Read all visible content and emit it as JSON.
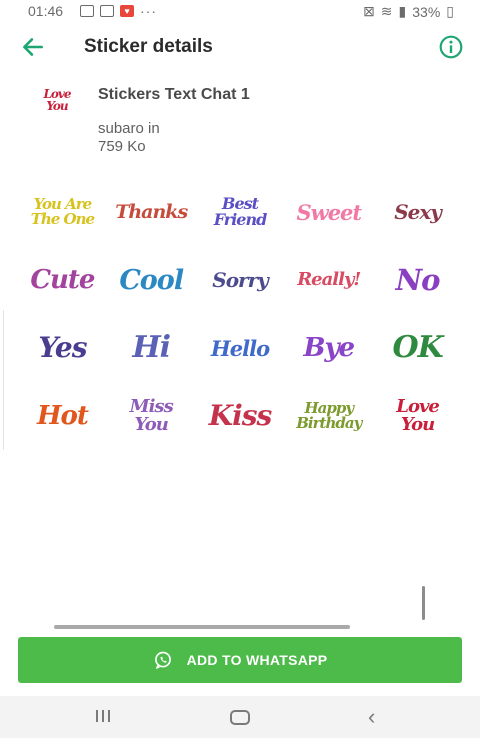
{
  "status_bar": {
    "time": "01:46",
    "battery": "33%"
  },
  "header": {
    "title": "Sticker details"
  },
  "pack": {
    "thumb_text": "Love You",
    "name": "Stickers Text Chat 1",
    "author": "subaro in",
    "size": "759 Ko"
  },
  "stickers": [
    {
      "text": "You Are The One",
      "color": "#d8c21d"
    },
    {
      "text": "Thanks",
      "color": "#c64b3b"
    },
    {
      "text": "Best Friend",
      "color": "#5a4fc4"
    },
    {
      "text": "Sweet",
      "color": "#f07aa5"
    },
    {
      "text": "Sexy",
      "color": "#8b3a4a"
    },
    {
      "text": "Cute",
      "color": "#a2439e"
    },
    {
      "text": "Cool",
      "color": "#2b88c3"
    },
    {
      "text": "Sorry",
      "color": "#4b4b8e"
    },
    {
      "text": "Really!",
      "color": "#d84b63"
    },
    {
      "text": "No",
      "color": "#8a3fc2"
    },
    {
      "text": "Yes",
      "color": "#4a3c8e"
    },
    {
      "text": "Hi",
      "color": "#5b62b6"
    },
    {
      "text": "Hello",
      "color": "#3f6ac9"
    },
    {
      "text": "Bye",
      "color": "#8944c8"
    },
    {
      "text": "OK",
      "color": "#2f8a3f"
    },
    {
      "text": "Hot",
      "color": "#e0581d"
    },
    {
      "text": "Miss You",
      "color": "#8d5cb8"
    },
    {
      "text": "Kiss",
      "color": "#c5324c"
    },
    {
      "text": "Happy Birthday",
      "color": "#7c9a2d"
    },
    {
      "text": "Love You",
      "color": "#c8203a"
    }
  ],
  "actions": {
    "add_label": "ADD TO WHATSAPP"
  },
  "colors": {
    "accent": "#1ea672",
    "button": "#4cbb4a"
  },
  "icons": {
    "back": "arrow-left-icon",
    "info": "info-icon",
    "whatsapp": "whatsapp-icon",
    "nav_recents": "recents-icon",
    "nav_home": "home-icon",
    "nav_back": "back-chevron-icon"
  }
}
